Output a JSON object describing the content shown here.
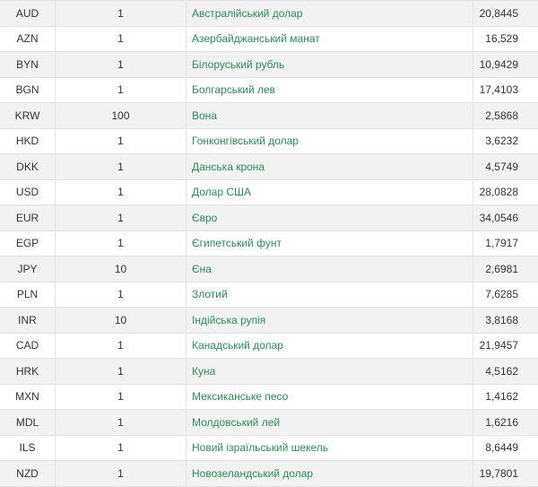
{
  "colors": {
    "row_alt_bg": "#f2f2f2",
    "row_bg": "#ffffff",
    "name_link": "#2e8b57",
    "grid_line": "#e3e3e3",
    "text": "#333333"
  },
  "rates": [
    {
      "code": "AUD",
      "units": "1",
      "name": "Австралійський долар",
      "rate": "20,8445"
    },
    {
      "code": "AZN",
      "units": "1",
      "name": "Азербайджанський манат",
      "rate": "16,529"
    },
    {
      "code": "BYN",
      "units": "1",
      "name": "Білоруський рубль",
      "rate": "10,9429"
    },
    {
      "code": "BGN",
      "units": "1",
      "name": "Болгарський лев",
      "rate": "17,4103"
    },
    {
      "code": "KRW",
      "units": "100",
      "name": "Вона",
      "rate": "2,5868"
    },
    {
      "code": "HKD",
      "units": "1",
      "name": "Гонконгівський долар",
      "rate": "3,6232"
    },
    {
      "code": "DKK",
      "units": "1",
      "name": "Данська крона",
      "rate": "4,5749"
    },
    {
      "code": "USD",
      "units": "1",
      "name": "Долар США",
      "rate": "28,0828"
    },
    {
      "code": "EUR",
      "units": "1",
      "name": "Євро",
      "rate": "34,0546"
    },
    {
      "code": "EGP",
      "units": "1",
      "name": "Єгипетський фунт",
      "rate": "1,7917"
    },
    {
      "code": "JPY",
      "units": "10",
      "name": "Єна",
      "rate": "2,6981"
    },
    {
      "code": "PLN",
      "units": "1",
      "name": "Злотий",
      "rate": "7,6285"
    },
    {
      "code": "INR",
      "units": "10",
      "name": "Індійська рупія",
      "rate": "3,8168"
    },
    {
      "code": "CAD",
      "units": "1",
      "name": "Канадський долар",
      "rate": "21,9457"
    },
    {
      "code": "HRK",
      "units": "1",
      "name": "Куна",
      "rate": "4,5162"
    },
    {
      "code": "MXN",
      "units": "1",
      "name": "Мексиканське песо",
      "rate": "1,4162"
    },
    {
      "code": "MDL",
      "units": "1",
      "name": "Молдовський лей",
      "rate": "1,6216"
    },
    {
      "code": "ILS",
      "units": "1",
      "name": "Новий ізраїльський шекель",
      "rate": "8,6449"
    },
    {
      "code": "NZD",
      "units": "1",
      "name": "Новозеландський долар",
      "rate": "19,7801"
    }
  ]
}
